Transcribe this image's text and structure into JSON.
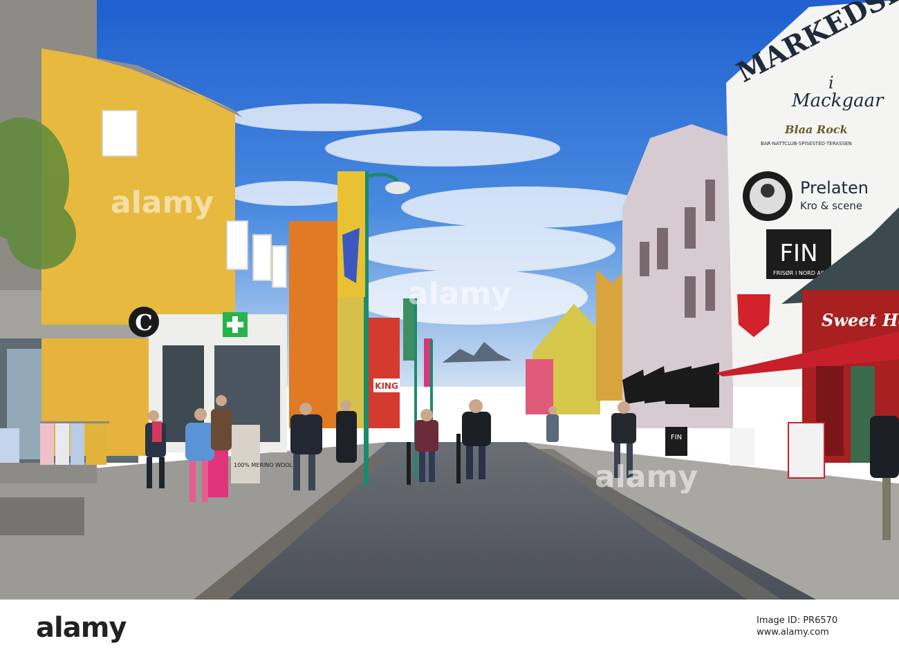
{
  "photo": {
    "description_colors": {
      "sky": "#2f6fd6",
      "road": "#565b63",
      "yellow_house": "#e8b93f",
      "white_building": "#f4f4f2",
      "lamp_post": "#1e8a6a"
    },
    "signs": {
      "wall_top": "MARKEDSPL",
      "wall_i": "i",
      "wall_script": "Mackgaar",
      "bar_logo": "Blaa Rock",
      "bar_sub": "BAR·NATTCLUB·SPISESTED·TERASSEN",
      "prelaten_title": "Prelaten",
      "prelaten_sub": "Kro & scene",
      "fin_title": "FIN",
      "fin_sub": "FRISØR I NORD AS",
      "sweetheart": "Sweet Heart",
      "shop_c": "C",
      "poster_wool": "100% MERINO WOOL",
      "sidewalk_fin": "FIN",
      "king": "KING"
    }
  },
  "footer": {
    "logo": "alamy",
    "image_id": "Image ID: PR6570",
    "url": "www.alamy.com"
  },
  "watermarks": [
    "alamy",
    "alamy",
    "alamy"
  ]
}
